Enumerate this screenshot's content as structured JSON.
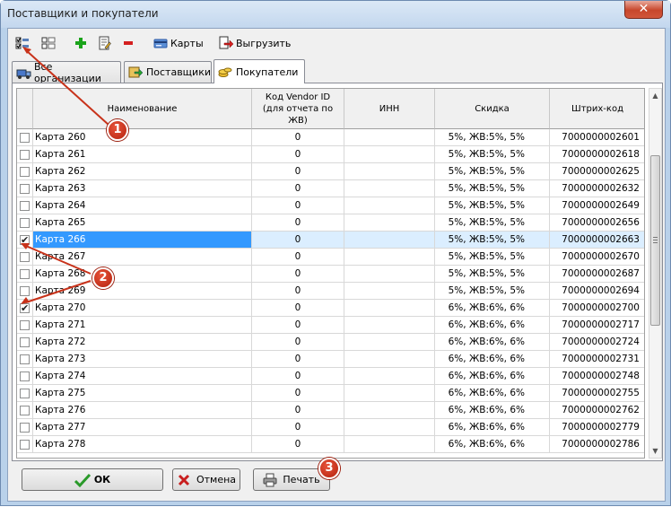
{
  "window": {
    "title": "Поставщики и покупатели",
    "close_label": "✕"
  },
  "toolbar": {
    "cards_label": "Карты",
    "export_label": "Выгрузить"
  },
  "tabs": [
    {
      "label": "Все организации"
    },
    {
      "label": "Поставщики"
    },
    {
      "label": "Покупатели"
    }
  ],
  "columns": [
    "Наименование",
    "Код Vendor ID (для отчета по ЖВ)",
    "ИНН",
    "Скидка",
    "Штрих-код"
  ],
  "rows": [
    {
      "name": "Карта 260",
      "code": "0",
      "inn": "",
      "discount": "5%, ЖВ:5%, 5%",
      "barcode": "7000000002601",
      "checked": ""
    },
    {
      "name": "Карта 261",
      "code": "0",
      "inn": "",
      "discount": "5%, ЖВ:5%, 5%",
      "barcode": "7000000002618",
      "checked": ""
    },
    {
      "name": "Карта 262",
      "code": "0",
      "inn": "",
      "discount": "5%, ЖВ:5%, 5%",
      "barcode": "7000000002625",
      "checked": ""
    },
    {
      "name": "Карта 263",
      "code": "0",
      "inn": "",
      "discount": "5%, ЖВ:5%, 5%",
      "barcode": "7000000002632",
      "checked": ""
    },
    {
      "name": "Карта 264",
      "code": "0",
      "inn": "",
      "discount": "5%, ЖВ:5%, 5%",
      "barcode": "7000000002649",
      "checked": ""
    },
    {
      "name": "Карта 265",
      "code": "0",
      "inn": "",
      "discount": "5%, ЖВ:5%, 5%",
      "barcode": "7000000002656",
      "checked": ""
    },
    {
      "name": "Карта 266",
      "code": "0",
      "inn": "",
      "discount": "5%, ЖВ:5%, 5%",
      "barcode": "7000000002663",
      "checked": "✔"
    },
    {
      "name": "Карта 267",
      "code": "0",
      "inn": "",
      "discount": "5%, ЖВ:5%, 5%",
      "barcode": "7000000002670",
      "checked": ""
    },
    {
      "name": "Карта 268",
      "code": "0",
      "inn": "",
      "discount": "5%, ЖВ:5%, 5%",
      "barcode": "7000000002687",
      "checked": ""
    },
    {
      "name": "Карта 269",
      "code": "0",
      "inn": "",
      "discount": "5%, ЖВ:5%, 5%",
      "barcode": "7000000002694",
      "checked": ""
    },
    {
      "name": "Карта 270",
      "code": "0",
      "inn": "",
      "discount": "6%, ЖВ:6%, 6%",
      "barcode": "7000000002700",
      "checked": "✔"
    },
    {
      "name": "Карта 271",
      "code": "0",
      "inn": "",
      "discount": "6%, ЖВ:6%, 6%",
      "barcode": "7000000002717",
      "checked": ""
    },
    {
      "name": "Карта 272",
      "code": "0",
      "inn": "",
      "discount": "6%, ЖВ:6%, 6%",
      "barcode": "7000000002724",
      "checked": ""
    },
    {
      "name": "Карта 273",
      "code": "0",
      "inn": "",
      "discount": "6%, ЖВ:6%, 6%",
      "barcode": "7000000002731",
      "checked": ""
    },
    {
      "name": "Карта 274",
      "code": "0",
      "inn": "",
      "discount": "6%, ЖВ:6%, 6%",
      "barcode": "7000000002748",
      "checked": ""
    },
    {
      "name": "Карта 275",
      "code": "0",
      "inn": "",
      "discount": "6%, ЖВ:6%, 6%",
      "barcode": "7000000002755",
      "checked": ""
    },
    {
      "name": "Карта 276",
      "code": "0",
      "inn": "",
      "discount": "6%, ЖВ:6%, 6%",
      "barcode": "7000000002762",
      "checked": ""
    },
    {
      "name": "Карта 277",
      "code": "0",
      "inn": "",
      "discount": "6%, ЖВ:6%, 6%",
      "barcode": "7000000002779",
      "checked": ""
    },
    {
      "name": "Карта 278",
      "code": "0",
      "inn": "",
      "discount": "6%, ЖВ:6%, 6%",
      "barcode": "7000000002786",
      "checked": ""
    }
  ],
  "selected_row": "Карта 266",
  "buttons": {
    "ok": "ОК",
    "cancel": "Отмена",
    "print": "Печать"
  },
  "callouts": [
    "1",
    "2",
    "3"
  ],
  "colors": {
    "selection": "#3399ff",
    "callout": "#c8321a",
    "add_icon": "#1aa31a",
    "delete_icon": "#d42020"
  }
}
